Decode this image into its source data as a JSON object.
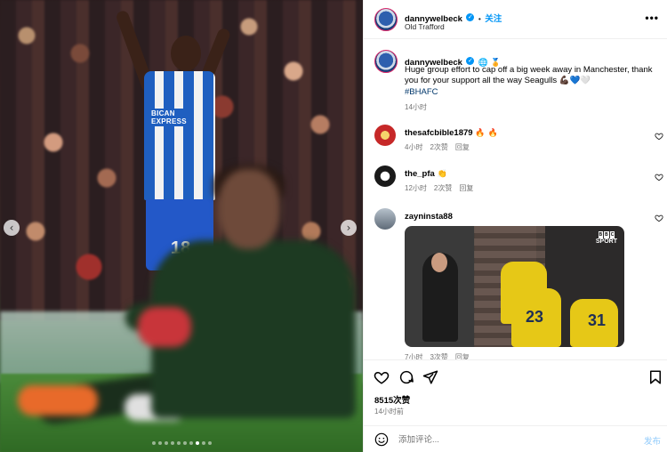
{
  "media": {
    "jersey_sponsor": "BICAN\nEXPRESS",
    "jersey_number": "18",
    "prev_glyph": "‹",
    "next_glyph": "›",
    "carousel_total": 10,
    "carousel_active": 7
  },
  "header": {
    "username": "dannywelbeck",
    "verified_glyph": "✓",
    "follow_label": "关注",
    "separator": "•",
    "location": "Old Trafford",
    "more_glyph": "•••"
  },
  "caption": {
    "username": "dannywelbeck",
    "badges": "🌐 🏅",
    "text": "Huge group effort to cap off a big week away in Manchester, thank you for your support all the way Seagulls 💪🏿💙🤍",
    "hashtag": "#BHAFC",
    "time": "14小时"
  },
  "comments": [
    {
      "username": "thesafcbible1879",
      "text": "🔥 🔥",
      "time": "4小时",
      "likes": "2次赞",
      "reply": "回复",
      "avatar_color": "#c62828"
    },
    {
      "username": "the_pfa",
      "text": "👏",
      "time": "12小时",
      "likes": "2次赞",
      "reply": "回复",
      "avatar_color": "#1a1a1a"
    },
    {
      "username": "zayninsta88",
      "text": "",
      "time": "7小时",
      "likes": "3次赞",
      "reply": "回复",
      "avatar_color": "#7f8c9a"
    }
  ],
  "gif": {
    "brand_top": "BBC",
    "brand_bottom": "SPORT",
    "numbers": [
      "23",
      "31"
    ]
  },
  "footer": {
    "likes": "8515次赞",
    "posted": "14小时前",
    "comment_placeholder": "添加评论...",
    "post_label": "发布"
  },
  "colors": {
    "accent": "#0095f6",
    "post_disabled": "#8fcafb",
    "muted": "#737373",
    "hashtag": "#00376b"
  },
  "icons": [
    "heart-icon",
    "comment-icon",
    "share-icon",
    "bookmark-icon",
    "smile-icon",
    "verified-icon",
    "more-icon",
    "chevron-left-icon",
    "chevron-right-icon"
  ]
}
